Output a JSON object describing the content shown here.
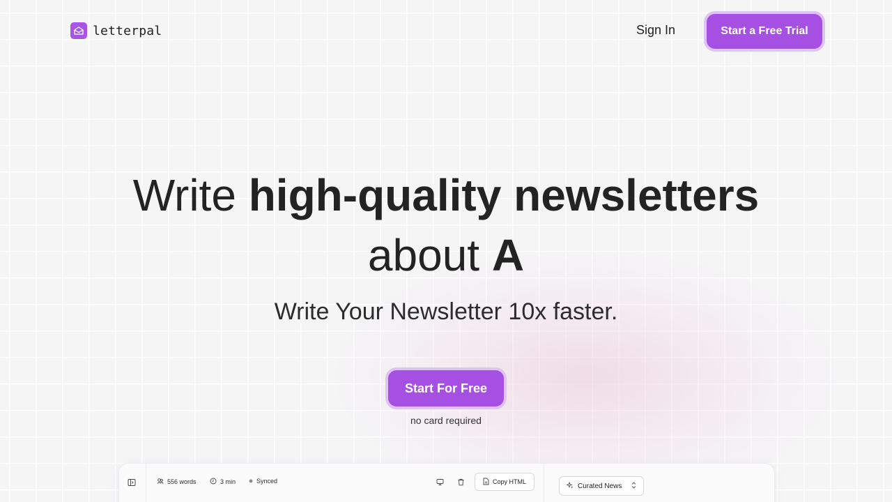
{
  "header": {
    "logo_text": "letterpal",
    "signin_label": "Sign In",
    "trial_label": "Start a Free Trial"
  },
  "hero": {
    "line1_light": "Write ",
    "line1_bold": "high-quality newsletters",
    "line2_light": "about ",
    "line2_bold": "A",
    "subtitle": "Write Your Newsletter 10x faster.",
    "cta_label": "Start For Free",
    "cta_note": "no card required"
  },
  "editor": {
    "word_count": "556 words",
    "read_time": "3 min",
    "sync_status": "Synced",
    "copy_label": "Copy HTML",
    "template_value": "Curated News",
    "icons": [
      "sidebar-toggle-icon",
      "words-icon",
      "clock-icon",
      "status-dot-icon",
      "monitor-icon",
      "trash-icon",
      "file-icon",
      "sparkle-icon",
      "chevron-updown-icon"
    ]
  },
  "colors": {
    "brand": "#a650e3",
    "brand_ring": "#dfc3f5",
    "background": "#f5f5f6"
  }
}
